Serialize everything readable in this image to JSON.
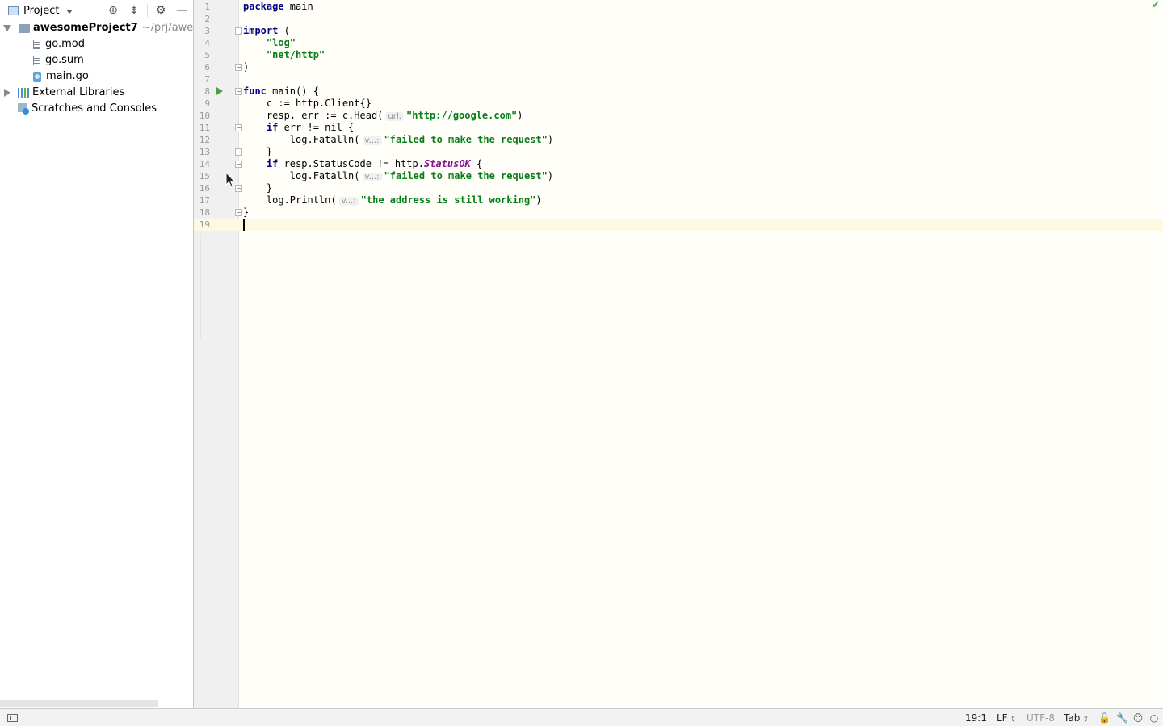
{
  "project_panel": {
    "title": "Project",
    "tree": [
      {
        "name": "awesomeProject7",
        "path": "~/prj/awesome",
        "expanded": true
      },
      {
        "name": "go.mod"
      },
      {
        "name": "go.sum"
      },
      {
        "name": "main.go"
      },
      {
        "name": "External Libraries",
        "expanded": false
      },
      {
        "name": "Scratches and Consoles"
      }
    ]
  },
  "editor": {
    "line_numbers": [
      "1",
      "2",
      "3",
      "4",
      "5",
      "6",
      "7",
      "8",
      "9",
      "10",
      "11",
      "12",
      "13",
      "14",
      "15",
      "16",
      "17",
      "18",
      "19"
    ],
    "hints": {
      "url": "url:",
      "v": "v...:"
    },
    "code": {
      "l1_kw": "package",
      "l1_rest": " main",
      "l3_kw": "import",
      "l3_rest": " (",
      "l4": "\"log\"",
      "l5": "\"net/http\"",
      "l6": ")",
      "l8_kw": "func",
      "l8_rest": " main() {",
      "l9": "c := http.Client{}",
      "l10_pre": "resp, err := c.Head(",
      "l10_str": "\"http://google.com\"",
      "l10_post": ")",
      "l11_kw": "if",
      "l11_rest": " err != nil {",
      "l12_pre": "log.Fatalln(",
      "l12_str": "\"failed to make the request\"",
      "l12_post": ")",
      "l13": "}",
      "l14_kw": "if",
      "l14_mid": " resp.StatusCode != http.",
      "l14_const": "StatusOK",
      "l14_post": " {",
      "l15_pre": "log.Fatalln(",
      "l15_str": "\"failed to make the request\"",
      "l15_post": ")",
      "l16": "}",
      "l17_pre": "log.Println(",
      "l17_str": "\"the address is still working\"",
      "l17_post": ")",
      "l18": "}"
    }
  },
  "status_bar": {
    "position": "19:1",
    "line_separator": "LF",
    "encoding": "UTF-8",
    "indent": "Tab"
  },
  "colors": {
    "keyword": "#000080",
    "string": "#067d17",
    "constant": "#871094",
    "caret_row": "#fdf8e2",
    "ok_check": "#4caf50"
  },
  "icons": [
    "project-view-icon",
    "locate-icon",
    "collapse-all-icon",
    "gear-icon",
    "minimize-icon",
    "folder-icon",
    "file-icon",
    "go-file-icon",
    "libraries-icon",
    "scratches-icon",
    "run-gutter-icon",
    "fold-marker-icon",
    "inspection-ok-icon",
    "readonly-lock-icon",
    "wrench-icon",
    "inspector-icon",
    "notifications-icon",
    "panel-toggle-icon"
  ]
}
